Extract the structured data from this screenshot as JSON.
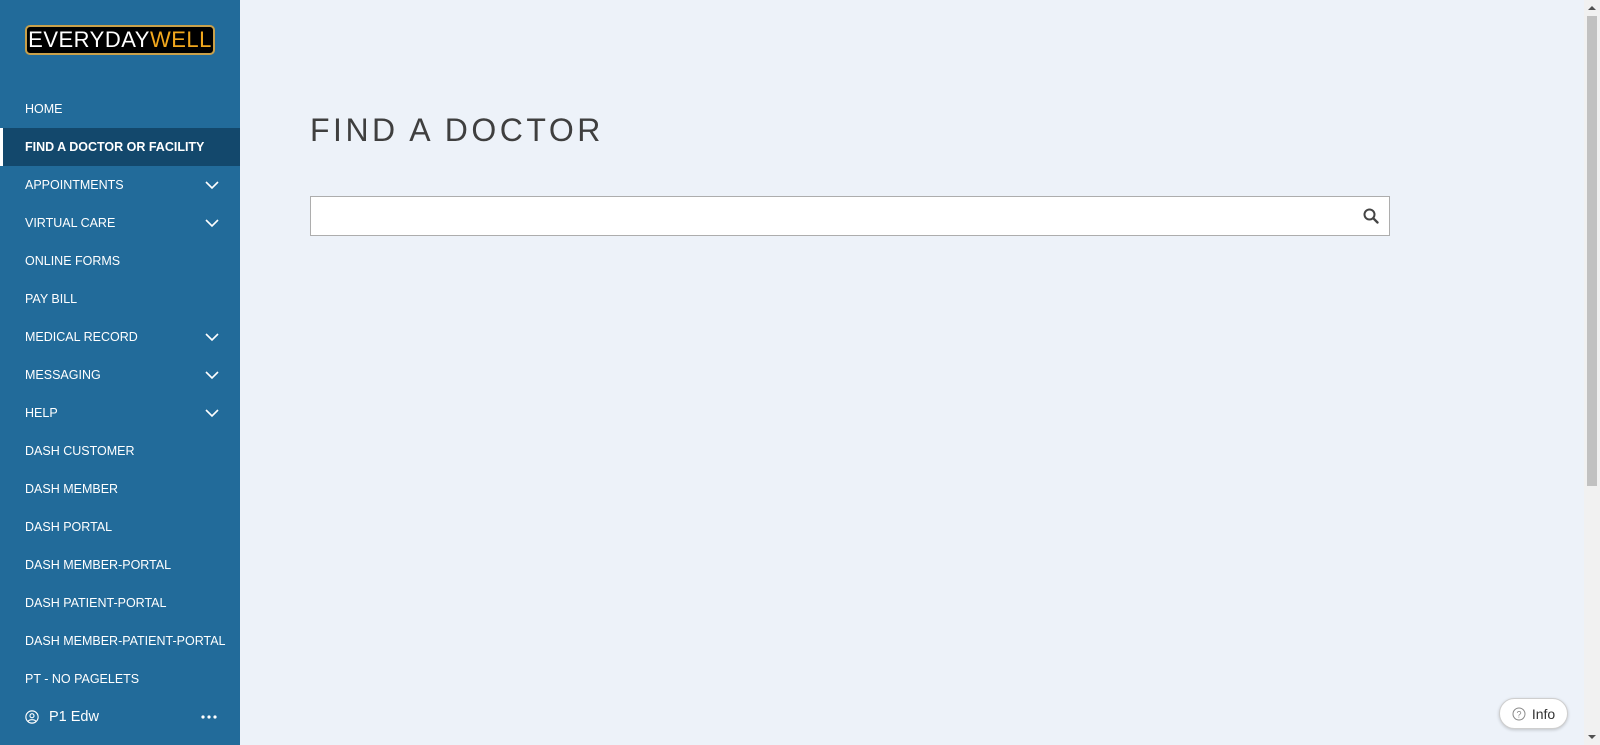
{
  "brand": {
    "part1": "EVERYDAY",
    "part2": "WELL"
  },
  "nav": [
    {
      "label": "HOME",
      "expandable": false,
      "active": false
    },
    {
      "label": "FIND A DOCTOR OR FACILITY",
      "expandable": false,
      "active": true
    },
    {
      "label": "APPOINTMENTS",
      "expandable": true,
      "active": false
    },
    {
      "label": "VIRTUAL CARE",
      "expandable": true,
      "active": false
    },
    {
      "label": "ONLINE FORMS",
      "expandable": false,
      "active": false
    },
    {
      "label": "PAY BILL",
      "expandable": false,
      "active": false
    },
    {
      "label": "MEDICAL RECORD",
      "expandable": true,
      "active": false
    },
    {
      "label": "MESSAGING",
      "expandable": true,
      "active": false
    },
    {
      "label": "HELP",
      "expandable": true,
      "active": false
    },
    {
      "label": "DASH CUSTOMER",
      "expandable": false,
      "active": false
    },
    {
      "label": "DASH MEMBER",
      "expandable": false,
      "active": false
    },
    {
      "label": "DASH PORTAL",
      "expandable": false,
      "active": false
    },
    {
      "label": "DASH MEMBER-PORTAL",
      "expandable": false,
      "active": false
    },
    {
      "label": "DASH PATIENT-PORTAL",
      "expandable": false,
      "active": false
    },
    {
      "label": "DASH MEMBER-PATIENT-PORTAL",
      "expandable": false,
      "active": false
    },
    {
      "label": "PT - NO PAGELETS",
      "expandable": false,
      "active": false
    }
  ],
  "user": {
    "name": "P1 Edw"
  },
  "page": {
    "title": "FIND A DOCTOR"
  },
  "search": {
    "value": "",
    "placeholder": ""
  },
  "info_button": {
    "label": "Info"
  },
  "colors": {
    "sidebar": "#226b9a",
    "sidebar_active": "#13486c",
    "page_bg": "#edf2f9",
    "brand_accent": "#f2a81d"
  },
  "icons": {
    "search": "search-icon",
    "chevron": "chevron-down-icon",
    "user": "user-circle-icon",
    "more": "more-horizontal-icon",
    "help": "question-circle-icon"
  }
}
